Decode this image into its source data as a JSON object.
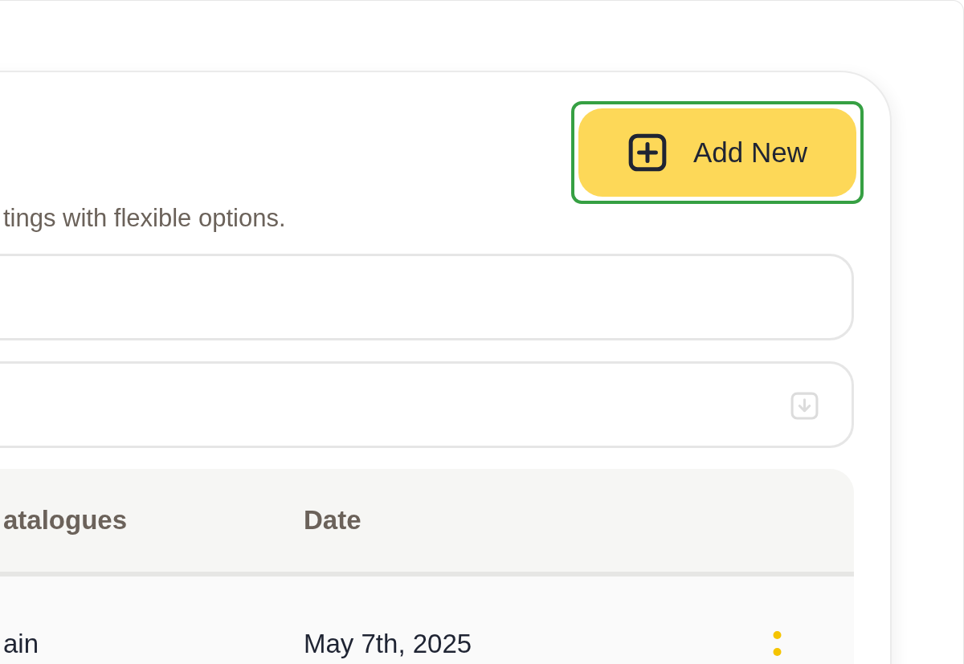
{
  "add_button": {
    "label": "Add New",
    "highlighted": true
  },
  "subtitle": "tings with flexible options.",
  "fields": [
    {
      "kind": "text"
    },
    {
      "kind": "with-icon"
    }
  ],
  "table": {
    "columns": [
      "atalogues",
      "Date"
    ],
    "rows": [
      {
        "cells": [
          "ain",
          "May 7th, 2025"
        ]
      }
    ]
  }
}
